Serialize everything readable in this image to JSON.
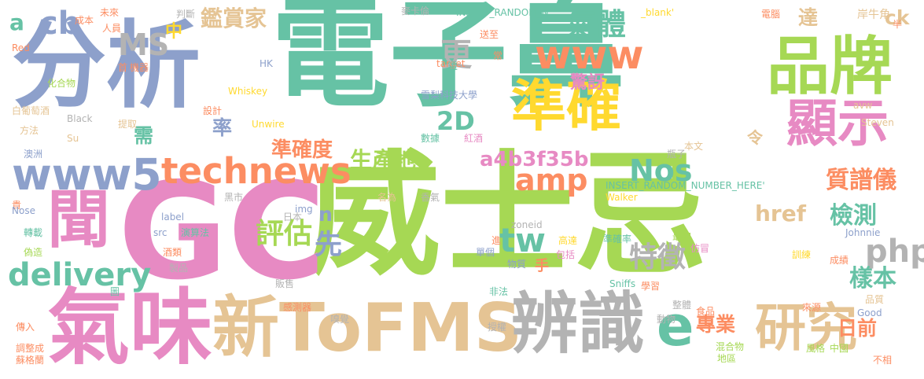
{
  "palette": {
    "green": "#66c2a5",
    "orange": "#fc8d62",
    "blue": "#8da0cb",
    "pink": "#e78ac3",
    "lime": "#a6d854",
    "yellow": "#ffd92f",
    "tan": "#e5c494",
    "gray": "#b3b3b3"
  },
  "words": [
    {
      "text": "電子鼻"
    },
    {
      "text": "威士忌"
    },
    {
      "text": "GC"
    },
    {
      "text": "分析"
    },
    {
      "text": "氣味"
    },
    {
      "text": "新ToFMS"
    },
    {
      "text": "辨識"
    },
    {
      "text": "品牌"
    },
    {
      "text": "準確"
    },
    {
      "text": "顯示"
    },
    {
      "text": "研究"
    },
    {
      "text": "聞"
    },
    {
      "text": "e"
    },
    {
      "text": "www5"
    },
    {
      "text": "www"
    },
    {
      "text": "technews"
    },
    {
      "text": "delivery"
    },
    {
      "text": "amp"
    },
    {
      "text": "tw"
    },
    {
      "text": "php"
    },
    {
      "text": "評估"
    },
    {
      "text": "Nos"
    },
    {
      "text": "氣體"
    },
    {
      "text": "MS"
    },
    {
      "text": "cb"
    },
    {
      "text": "2D"
    },
    {
      "text": "先"
    },
    {
      "text": "更"
    },
    {
      "text": "檢測"
    },
    {
      "text": "特徵"
    },
    {
      "text": "樣本"
    },
    {
      "text": "質譜儀"
    },
    {
      "text": "href"
    },
    {
      "text": "a4b3f35b"
    },
    {
      "text": "準確度"
    },
    {
      "text": "生產地"
    },
    {
      "text": "鑑賞家"
    },
    {
      "text": "專業"
    },
    {
      "text": "日前"
    },
    {
      "text": "驚訝"
    },
    {
      "text": "達"
    },
    {
      "text": "ck"
    },
    {
      "text": "率"
    },
    {
      "text": "需"
    },
    {
      "text": "中"
    },
    {
      "text": "a"
    },
    {
      "text": "n"
    },
    {
      "text": "手"
    },
    {
      "text": "令"
    },
    {
      "text": "INSERT_RANDOM_N"
    },
    {
      "text": "INSERT_RANDOM_NUMBER_HERE'"
    },
    {
      "text": "_blank'"
    },
    {
      "text": "電腦"
    },
    {
      "text": "岸牛角"
    },
    {
      "text": "半"
    },
    {
      "text": "未來"
    },
    {
      "text": "判斷"
    },
    {
      "text": "麥卡倫"
    },
    {
      "text": "送至"
    },
    {
      "text": "成本"
    },
    {
      "text": "人員"
    },
    {
      "text": "Red"
    },
    {
      "text": "target"
    },
    {
      "text": "常"
    },
    {
      "text": "遭"
    },
    {
      "text": "首"
    },
    {
      "text": "機器"
    },
    {
      "text": "HK"
    },
    {
      "text": "Whiskey"
    },
    {
      "text": "化合物"
    },
    {
      "text": "雪梨科技大學"
    },
    {
      "text": "白葡萄酒"
    },
    {
      "text": "設計"
    },
    {
      "text": "Black"
    },
    {
      "text": "方法"
    },
    {
      "text": "提取"
    },
    {
      "text": "Unwire"
    },
    {
      "text": "avw"
    },
    {
      "text": "Steven"
    },
    {
      "text": "澳洲"
    },
    {
      "text": "Su"
    },
    {
      "text": "數據"
    },
    {
      "text": "紅酒"
    },
    {
      "text": "本文"
    },
    {
      "text": "瓶子"
    },
    {
      "text": "貴"
    },
    {
      "text": "黑市"
    },
    {
      "text": "香氣"
    },
    {
      "text": "名為"
    },
    {
      "text": "Walker"
    },
    {
      "text": "Nose"
    },
    {
      "text": "label"
    },
    {
      "text": "日本"
    },
    {
      "text": "img"
    },
    {
      "text": "zoneid"
    },
    {
      "text": "轉載"
    },
    {
      "text": "src"
    },
    {
      "text": "演算法"
    },
    {
      "text": "進"
    },
    {
      "text": "Johnnie"
    },
    {
      "text": "偽造"
    },
    {
      "text": "單個"
    },
    {
      "text": "高達"
    },
    {
      "text": "最初"
    },
    {
      "text": "酒類"
    },
    {
      "text": "準確率"
    },
    {
      "text": "仿冒"
    },
    {
      "text": "物質"
    },
    {
      "text": "包括"
    },
    {
      "text": "訓練"
    },
    {
      "text": "製品"
    },
    {
      "text": "販售"
    },
    {
      "text": "成績"
    },
    {
      "text": "Sniffs"
    },
    {
      "text": "學習"
    },
    {
      "text": "非法"
    },
    {
      "text": "圖"
    },
    {
      "text": "感測器"
    },
    {
      "text": "整體"
    },
    {
      "text": "食品"
    },
    {
      "text": "來源"
    },
    {
      "text": "品質"
    },
    {
      "text": "傳入"
    },
    {
      "text": "嗅覺"
    },
    {
      "text": "動物"
    },
    {
      "text": "Good"
    },
    {
      "text": "授權"
    },
    {
      "text": "混合物"
    },
    {
      "text": "風格"
    },
    {
      "text": "中國"
    },
    {
      "text": "調整成"
    },
    {
      "text": "蘇格蘭"
    },
    {
      "text": "地區"
    },
    {
      "text": "不相"
    }
  ]
}
